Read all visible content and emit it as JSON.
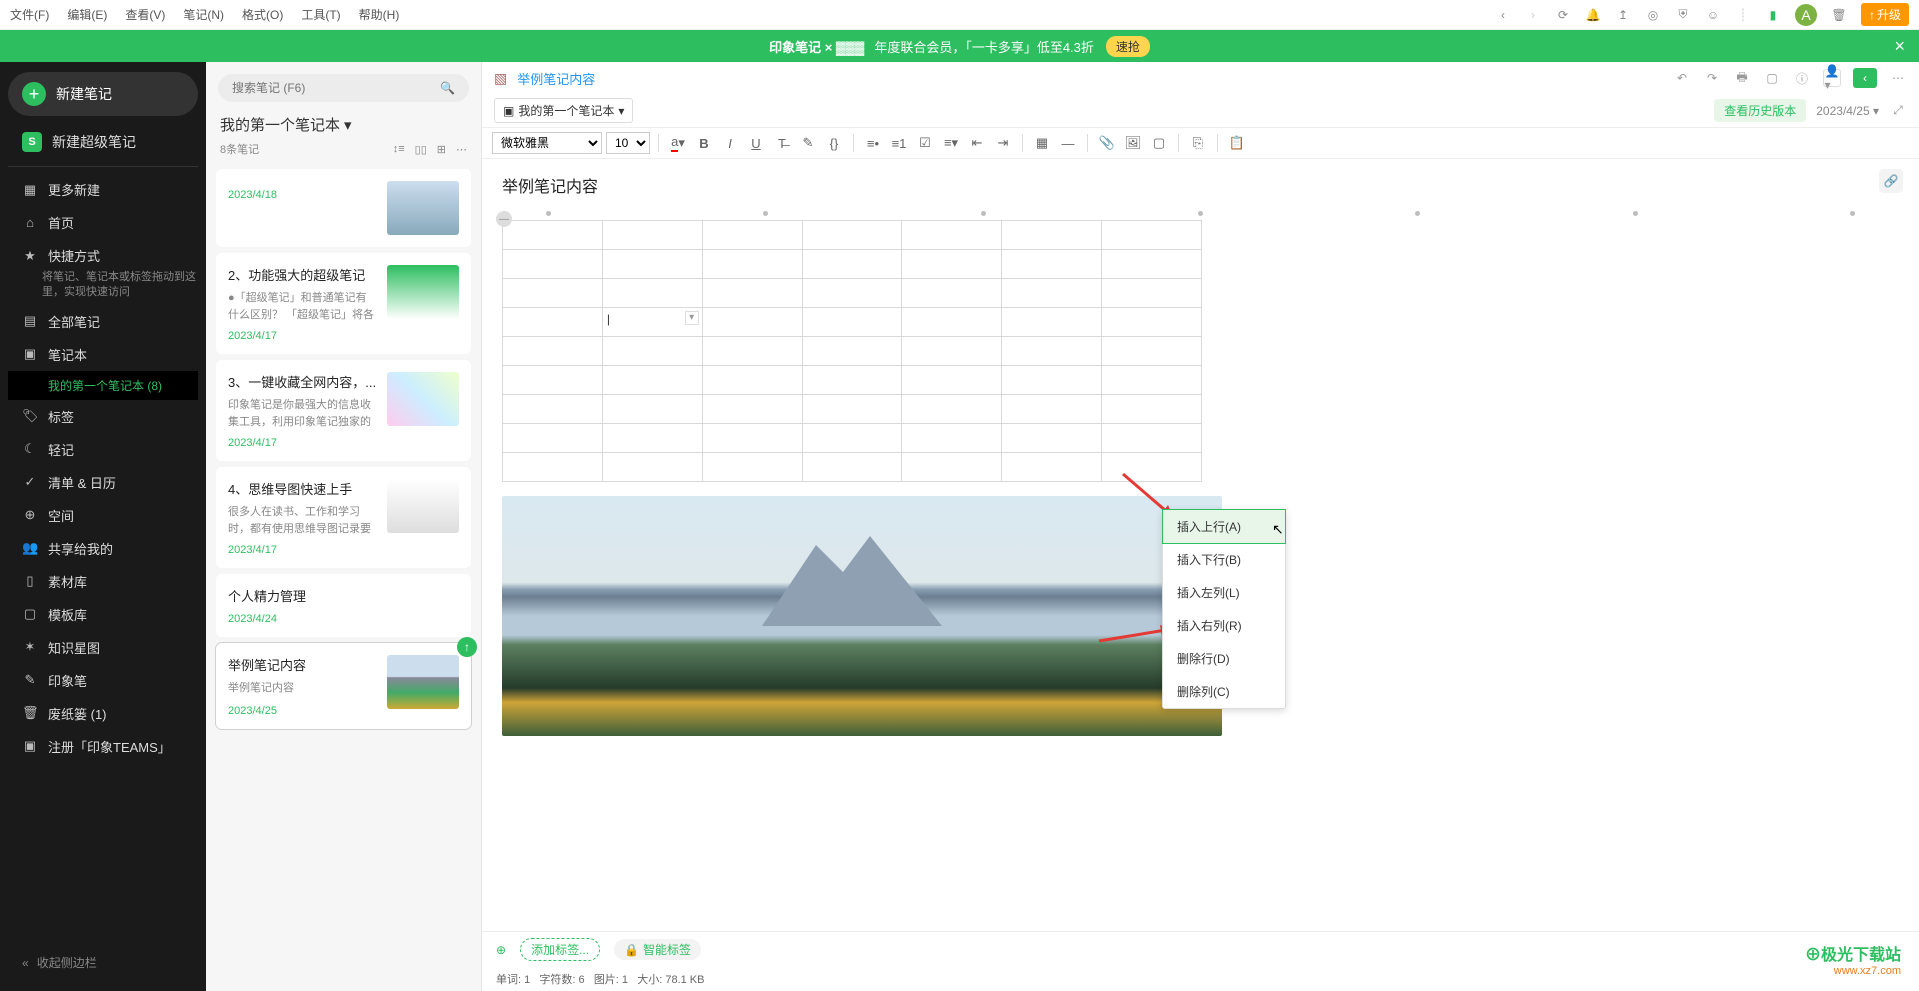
{
  "menubar": {
    "file": "文件(F)",
    "edit": "编辑(E)",
    "view": "查看(V)",
    "note": "笔记(N)",
    "format": "格式(O)",
    "tools": "工具(T)",
    "help": "帮助(H)",
    "upgrade": "升级"
  },
  "promo": {
    "brand": "印象笔记 × ▓▓▓",
    "text": "年度联合会员，「一卡多享」低至4.3折",
    "btn": "速抢"
  },
  "sidebar": {
    "new_note": "新建笔记",
    "new_super": "新建超级笔记",
    "more_new": "更多新建",
    "home": "首页",
    "shortcut": "快捷方式",
    "shortcut_desc": "将笔记、笔记本或标签拖动到这里，实现快速访问",
    "all_notes": "全部笔记",
    "notebooks": "笔记本",
    "notebook_sub": "我的第一个笔记本  (8)",
    "tags": "标签",
    "qingji": "轻记",
    "checklist": "清单 & 日历",
    "space": "空间",
    "shared": "共享给我的",
    "material": "素材库",
    "template": "模板库",
    "knowledge": "知识星图",
    "yinxiangbi": "印象笔",
    "trash": "废纸篓  (1)",
    "teams": "注册「印象TEAMS」",
    "collapse": "收起侧边栏"
  },
  "notelist": {
    "search_placeholder": "搜索笔记 (F6)",
    "title": "我的第一个笔记本",
    "count": "8条笔记",
    "items": [
      {
        "title": "",
        "snippet": "",
        "date": "2023/4/18"
      },
      {
        "title": "2、功能强大的超级笔记",
        "snippet": "●「超级笔记」和普通笔记有什么区别？ 「超级笔记」将各种...",
        "date": "2023/4/17"
      },
      {
        "title": "3、一键收藏全网内容，...",
        "snippet": "印象笔记是你最强大的信息收集工具，利用印象笔记独家的剪...",
        "date": "2023/4/17"
      },
      {
        "title": "4、思维导图快速上手",
        "snippet": "很多人在读书、工作和学习时，都有使用思维导图记录要点...",
        "date": "2023/4/17"
      },
      {
        "title": "个人精力管理",
        "snippet": "",
        "date": "2023/4/24"
      },
      {
        "title": "举例笔记内容",
        "snippet": "举例笔记内容",
        "date": "2023/4/25"
      }
    ]
  },
  "editor": {
    "title_link": "举例笔记内容",
    "notebook": "我的第一个笔记本",
    "view_history": "查看历史版本",
    "date": "2023/4/25",
    "font": "微软雅黑",
    "fontsize": "10",
    "heading": "举例笔记内容",
    "add_tag": "添加标签...",
    "smart_tag": "智能标签"
  },
  "context_menu": {
    "insert_row_above": "插入上行(A)",
    "insert_row_below": "插入下行(B)",
    "insert_col_left": "插入左列(L)",
    "insert_col_right": "插入右列(R)",
    "delete_row": "删除行(D)",
    "delete_col": "删除列(C)"
  },
  "status": {
    "words": "单词:  1",
    "chars": "字符数:  6",
    "images": "图片:  1",
    "size": "大小:  78.1 KB"
  },
  "watermark": {
    "line1": "⊕极光下载站",
    "line2": "www.xz7.com"
  }
}
